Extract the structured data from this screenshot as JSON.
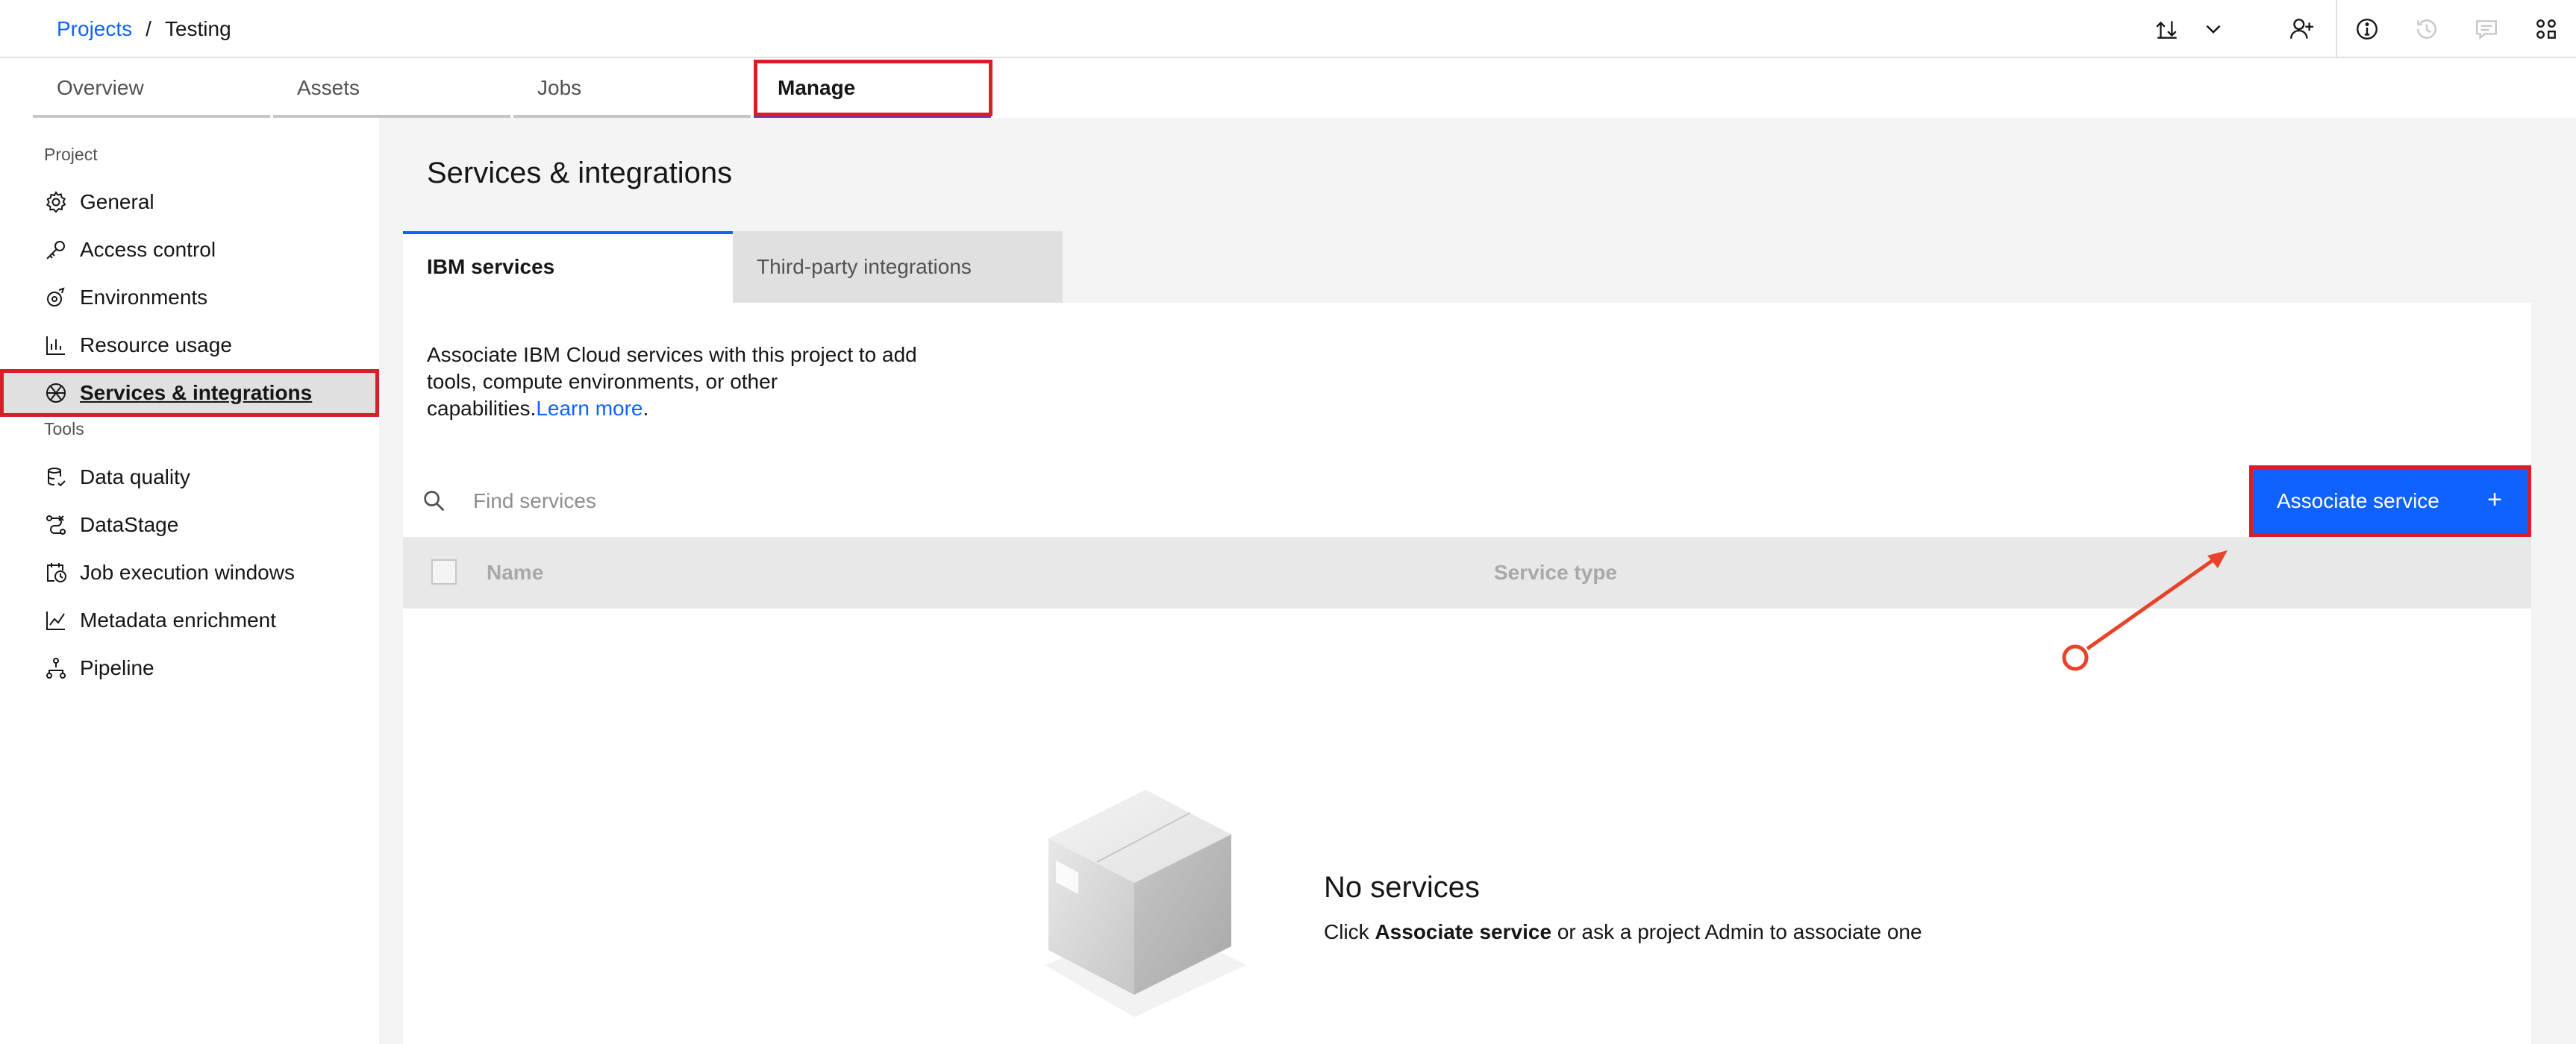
{
  "header": {
    "breadcrumb": {
      "root": "Projects",
      "separator": "/",
      "current": "Testing"
    },
    "icons": [
      "upload-download-icon",
      "chevron-down-icon",
      "add-collaborator-icon",
      "information-icon",
      "history-icon",
      "comment-icon",
      "apps-icon"
    ]
  },
  "tabs": [
    {
      "label": "Overview"
    },
    {
      "label": "Assets"
    },
    {
      "label": "Jobs"
    },
    {
      "label": "Manage",
      "active": true
    }
  ],
  "sidebar": {
    "project_section": "Project",
    "project_items": [
      {
        "label": "General",
        "icon": "gear-icon"
      },
      {
        "label": "Access control",
        "icon": "key-icon"
      },
      {
        "label": "Environments",
        "icon": "environment-icon"
      },
      {
        "label": "Resource usage",
        "icon": "bar-chart-icon"
      },
      {
        "label": "Services & integrations",
        "icon": "integration-icon",
        "active": true
      }
    ],
    "tools_section": "Tools",
    "tool_items": [
      {
        "label": "Data quality",
        "icon": "data-quality-icon"
      },
      {
        "label": "DataStage",
        "icon": "datastage-icon"
      },
      {
        "label": "Job execution windows",
        "icon": "calendar-clock-icon"
      },
      {
        "label": "Metadata enrichment",
        "icon": "chart-line-icon"
      },
      {
        "label": "Pipeline",
        "icon": "flow-icon"
      }
    ]
  },
  "main": {
    "title": "Services & integrations",
    "sub_tabs": {
      "ibm": "IBM services",
      "third_party": "Third-party integrations"
    },
    "description": "Associate IBM Cloud services with this project to add tools, compute environments, or other capabilities.",
    "learn_more": "Learn more",
    "learn_more_suffix": ".",
    "search_placeholder": "Find services",
    "associate_button": "Associate service",
    "associate_plus": "+",
    "table": {
      "col_name": "Name",
      "col_type": "Service type"
    },
    "empty": {
      "title": "No services",
      "text_prefix": "Click ",
      "text_bold": "Associate service",
      "text_suffix": " or ask a project Admin to associate one"
    }
  },
  "colors": {
    "primary": "#0f62fe",
    "highlight": "#da1e28",
    "active_tab": "#6f2bd8",
    "background": "#f4f4f4"
  }
}
